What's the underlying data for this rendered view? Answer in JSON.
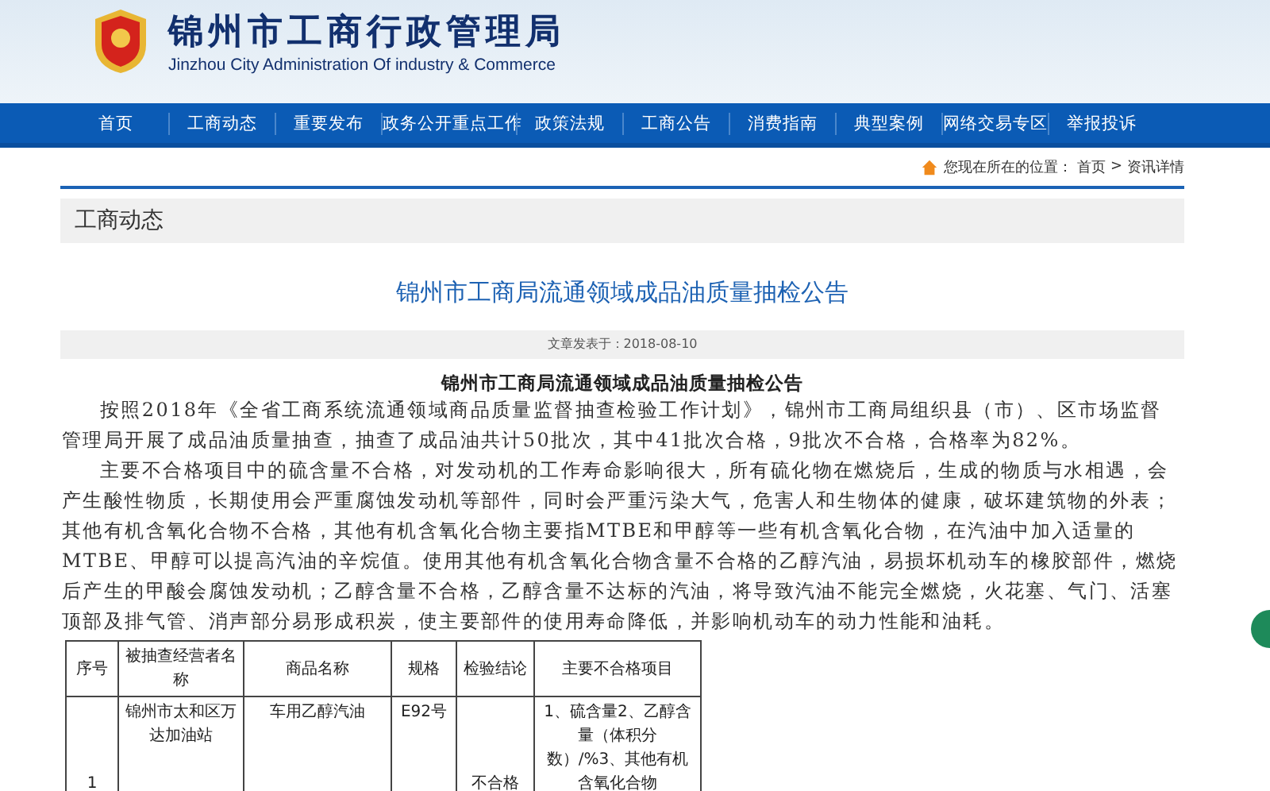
{
  "header": {
    "title": "锦州市工商行政管理局",
    "subtitle": "Jinzhou City Administration Of industry & Commerce"
  },
  "nav": [
    {
      "label": "首页",
      "selected": false
    },
    {
      "label": "工商动态",
      "selected": false
    },
    {
      "label": "重要发布",
      "selected": false
    },
    {
      "label": "政务公开重点工作",
      "selected": false
    },
    {
      "label": "政策法规",
      "selected": false
    },
    {
      "label": "工商公告",
      "selected": false
    },
    {
      "label": "消费指南",
      "selected": false
    },
    {
      "label": "典型案例",
      "selected": false
    },
    {
      "label": "网络交易专区",
      "selected": false
    },
    {
      "label": "举报投诉",
      "selected": false
    }
  ],
  "breadcrumb": {
    "prefix": "您现在所在的位置：",
    "items": [
      "首页",
      "资讯详情"
    ],
    "separator": ">"
  },
  "section_title": "工商动态",
  "article": {
    "title": "锦州市工商局流通领域成品油质量抽检公告",
    "date": "文章发表于：2018-08-10",
    "heading": "锦州市工商局流通领域成品油质量抽检公告",
    "paragraphs": [
      "按照2018年《全省工商系统流通领域商品质量监督抽查检验工作计划》，锦州市工商局组织县（市）、区市场监督管理局开展了成品油质量抽查，抽查了成品油共计50批次，其中41批次合格，9批次不合格，合格率为82%。",
      "主要不合格项目中的硫含量不合格，对发动机的工作寿命影响很大，所有硫化物在燃烧后，生成的物质与水相遇，会产生酸性物质，长期使用会严重腐蚀发动机等部件，同时会严重污染大气，危害人和生物体的健康，破坏建筑物的外表；其他有机含氧化合物不合格，其他有机含氧化合物主要指MTBE和甲醇等一些有机含氧化合物，在汽油中加入适量的MTBE、甲醇可以提高汽油的辛烷值。使用其他有机含氧化合物含量不合格的乙醇汽油，易损坏机动车的橡胶部件，燃烧后产生的甲酸会腐蚀发动机；乙醇含量不合格，乙醇含量不达标的汽油，将导致汽油不能完全燃烧，火花塞、气门、活塞顶部及排气管、消声部分易形成积炭，使主要部件的使用寿命降低，并影响机动车的动力性能和油耗。"
    ],
    "table": {
      "columns": [
        "序号",
        "被抽查经营者名称",
        "商品名称",
        "规格",
        "检验结论",
        "主要不合格项目"
      ],
      "rows": [
        [
          "1",
          "锦州市太和区万达加油站",
          "车用乙醇汽油",
          "E92号",
          "不合格",
          "1、硫含量2、乙醇含量（体积分数）/%3、其他有机含氧化合物"
        ]
      ]
    }
  }
}
